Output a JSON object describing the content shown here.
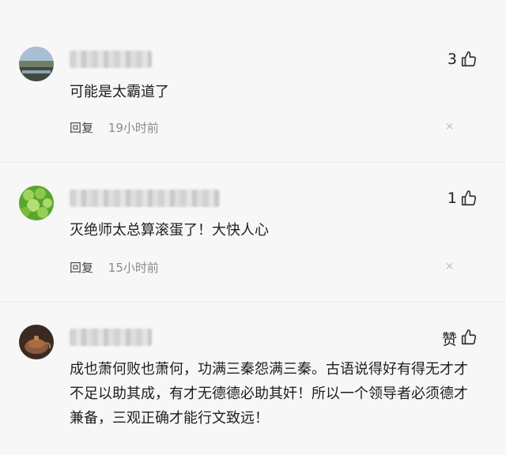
{
  "comments": [
    {
      "likes": "3",
      "text": "可能是太霸道了",
      "reply_label": "回复",
      "time": "19小时前",
      "close_glyph": "×"
    },
    {
      "likes": "1",
      "text": "灭绝师太总算滚蛋了！大快人心",
      "reply_label": "回复",
      "time": "15小时前",
      "close_glyph": "×"
    },
    {
      "likes": "赞",
      "text": "成也萧何败也萧何，功满三秦怨满三秦。古语说得好有得无才才不足以助其成，有才无德德必助其奸！所以一个领导者必须德才兼备，三观正确才能行文致远！"
    }
  ],
  "icons": {
    "like": "thumbs-up-icon",
    "close": "close-icon"
  }
}
